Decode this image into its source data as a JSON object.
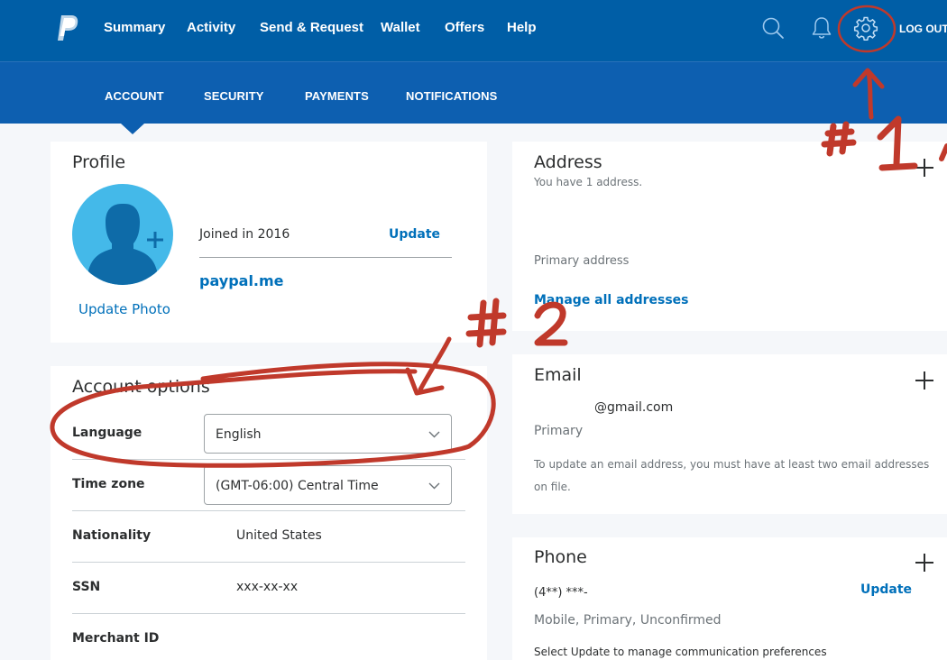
{
  "topnav": {
    "items": [
      "Summary",
      "Activity",
      "Send & Request",
      "Wallet",
      "Offers",
      "Help"
    ],
    "logout": "LOG OUT"
  },
  "icons": {
    "logo": "paypal-logo",
    "search": "search-icon",
    "notifications": "bell-icon",
    "settings": "gear-icon"
  },
  "subnav": {
    "tabs": [
      "ACCOUNT",
      "SECURITY",
      "PAYMENTS",
      "NOTIFICATIONS"
    ],
    "active": "ACCOUNT"
  },
  "profile": {
    "title": "Profile",
    "joined": "Joined in 2016",
    "update_label": "Update",
    "paypalme": "paypal.me",
    "update_photo": "Update Photo"
  },
  "account_options": {
    "title": "Account options",
    "language_label": "Language",
    "language_value": "English",
    "timezone_label": "Time zone",
    "timezone_value": "(GMT-06:00) Central Time",
    "nationality_label": "Nationality",
    "nationality_value": "United States",
    "ssn_label": "SSN",
    "ssn_value": "xxx-xx-xx",
    "merchant_label": "Merchant ID"
  },
  "address": {
    "title": "Address",
    "count_text": "You have 1 address.",
    "primary_label": "Primary address",
    "manage_link": "Manage all addresses"
  },
  "email": {
    "title": "Email",
    "address": "@gmail.com",
    "status": "Primary",
    "note": "To update an email address, you must have at least two email addresses on file."
  },
  "phone": {
    "title": "Phone",
    "number": "(4**) ***-",
    "update_label": "Update",
    "status": "Mobile, Primary, Unconfirmed",
    "note": "Select Update to manage communication preferences"
  },
  "annotations": {
    "one": "#1",
    "two": "#2"
  },
  "colors": {
    "topbar": "#005ea6",
    "subbar": "#0d5fb0",
    "link": "#0070ba",
    "annotation": "#c0392b"
  }
}
